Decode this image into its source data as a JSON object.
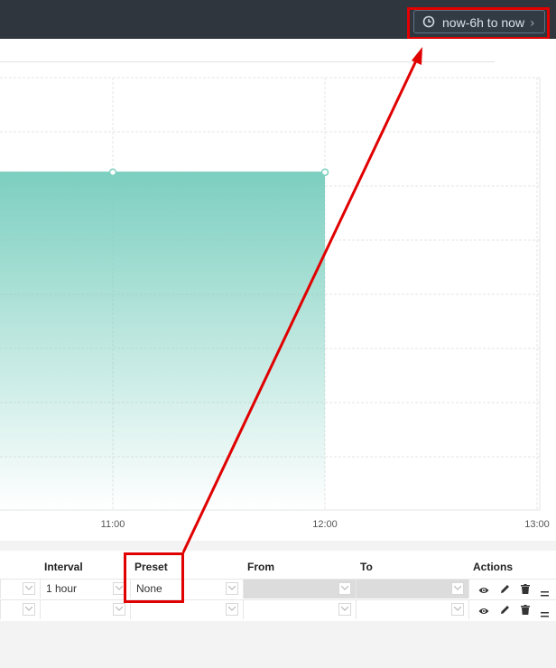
{
  "header": {
    "time_range_label": "now-6h to now",
    "chevron": "›",
    "clock_icon": "clock-icon"
  },
  "chart_data": {
    "type": "area",
    "title": "",
    "xlabel": "",
    "ylabel": "",
    "x_ticks": [
      "11:00",
      "12:00",
      "13:00"
    ],
    "x": [
      "11:00",
      "12:00"
    ],
    "series": [
      {
        "values": [
          1,
          1
        ]
      }
    ],
    "grid": true,
    "fill_color": "#7ccfc0",
    "line_color": "#7ccfc0"
  },
  "table": {
    "headers": {
      "interval": "Interval",
      "preset": "Preset",
      "from": "From",
      "to": "To",
      "actions": "Actions"
    },
    "rows": [
      {
        "interval": "1 hour",
        "preset": "None",
        "from": "",
        "to": ""
      },
      {
        "interval": "",
        "preset": "",
        "from": "",
        "to": ""
      }
    ],
    "action_icons": [
      "eye-icon",
      "pencil-icon",
      "trash-icon",
      "drag-handle-icon"
    ]
  },
  "colors": {
    "highlight": "#e00000",
    "topbar": "#2f363d",
    "accent": "#7ccfc0"
  }
}
